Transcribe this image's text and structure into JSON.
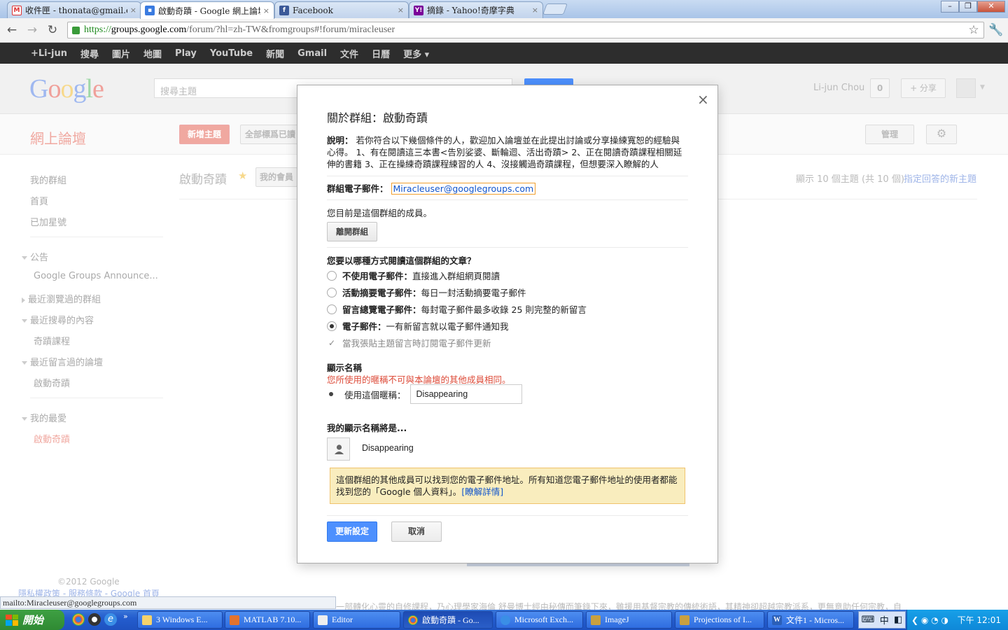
{
  "browser": {
    "tabs": [
      {
        "title": "收件匣 - thonata@gmail.com",
        "icon": "gmail-icon"
      },
      {
        "title": "啟動奇蹟 - Google 網上論壇",
        "icon": "groups-icon"
      },
      {
        "title": "Facebook",
        "icon": "facebook-icon"
      },
      {
        "title": "摘錄 - Yahoo!奇摩字典",
        "icon": "yahoo-icon"
      }
    ],
    "close_glyph": "×",
    "url_scheme": "https://",
    "url_host": "groups.google.com",
    "url_path": "/forum/?hl=zh-TW&fromgroups#!forum/miracleuser"
  },
  "gbar": {
    "items": [
      "+Li-jun",
      "搜尋",
      "圖片",
      "地圖",
      "Play",
      "YouTube",
      "新聞",
      "Gmail",
      "文件",
      "日曆",
      "更多 ▾"
    ]
  },
  "page": {
    "search_placeholder": "搜尋主題",
    "user_name": "Li-jun Chou",
    "notif_count": "0",
    "share_label": "+ 分享",
    "section_title": "網上論壇",
    "new_topic": "新增主題",
    "mark_all_read": "全部標爲已讀",
    "manage": "管理",
    "group_title": "啟動奇蹟",
    "member_btn": "我的會員",
    "topic_count": "顯示 10 個主題 (共 10 個)",
    "assign_topics": "指定回答的新主題",
    "sidebar": {
      "my_groups": "我的群組",
      "home": "首頁",
      "starred": "已加星號",
      "announcements": "公告",
      "gg_announce": "Google Groups Announce...",
      "recent_browsed": "最近瀏覽過的群組",
      "recent_search": "最近搜尋的內容",
      "miracle_course": "奇蹟課程",
      "recent_posted": "最近留言過的論壇",
      "start_miracle": "啟動奇蹟",
      "favorites": "我的最愛",
      "fav_miracle": "啟動奇蹟"
    },
    "copyright": "©2012 Google",
    "footer_links": "隱私權政策 - 服務條款 - Google 首頁",
    "bottom_snippet": "一部轉化心靈的自修課程，乃心理學家海倫 舒曼博士經由秘傳而筆錄下來，雖援用基督宗教的傳統術語，其精神卻超越宗教派系，更無意助任何宗教，自"
  },
  "dialog": {
    "close_glyph": "×",
    "title": "關於群組：啟動奇蹟",
    "desc_label": "說明：",
    "desc_text": "若你符合以下幾個條件的人，歡迎加入論壇並在此提出討論或分享操練寬恕的經驗與心得。 1、有在閱讀這三本書<告別娑婆、斷輪迴、活出奇蹟> 2、正在閱讀奇蹟課程相關延伸的書籍 3、正在操練奇蹟課程練習的人 4、沒接觸過奇蹟課程，但想要深入瞭解的人",
    "email_label": "群組電子郵件：",
    "email_value": "Miracleuser@googlegroups.com",
    "member_text": "您目前是這個群組的成員。",
    "leave_btn": "離開群組",
    "read_question": "您要以哪種方式閱讀這個群組的文章？",
    "options": [
      {
        "label": "不使用電子郵件：",
        "desc": "直接進入群組網頁閱讀",
        "checked": false
      },
      {
        "label": "活動摘要電子郵件：",
        "desc": "每日一封活動摘要電子郵件",
        "checked": false
      },
      {
        "label": "留言總覽電子郵件：",
        "desc": "每封電子郵件最多收錄 25 則完整的新留言",
        "checked": false
      },
      {
        "label": "電子郵件：",
        "desc": "一有新留言就以電子郵件通知我",
        "checked": true
      }
    ],
    "subscribe_text": "當我張貼主題留言時訂閱電子郵件更新",
    "display_name_heading": "顯示名稱",
    "display_name_warning": "您所使用的暱稱不可與本論壇的其他成員相同。",
    "use_nickname_label": "使用這個暱稱：",
    "nickname_value": "Disappearing",
    "my_display_heading": "我的顯示名稱將是...",
    "my_display_value": "Disappearing",
    "notice_text": "這個群組的其他成員可以找到您的電子郵件地址。所有知道您電子郵件地址的使用者都能找到您的「Google 個人資料」。",
    "notice_link": "[瞭解詳情]",
    "update_btn": "更新設定",
    "cancel_btn": "取消"
  },
  "status": {
    "text": "mailto:Miracleuser@googlegroups.com"
  },
  "taskbar": {
    "start": "開始",
    "buttons": [
      "3 Windows E...",
      "MATLAB 7.10...",
      "Editor",
      "啟動奇蹟 - Go...",
      "Microsoft Exch...",
      "ImageJ",
      "Projections of I...",
      "文件1 - Micros..."
    ],
    "ime": "中",
    "clock": "下午 12:01"
  },
  "colors": {
    "accent_blue": "#4d90fe",
    "warning_red": "#dd4b39",
    "notice_bg": "#f9edbe",
    "link": "#1155cc"
  }
}
